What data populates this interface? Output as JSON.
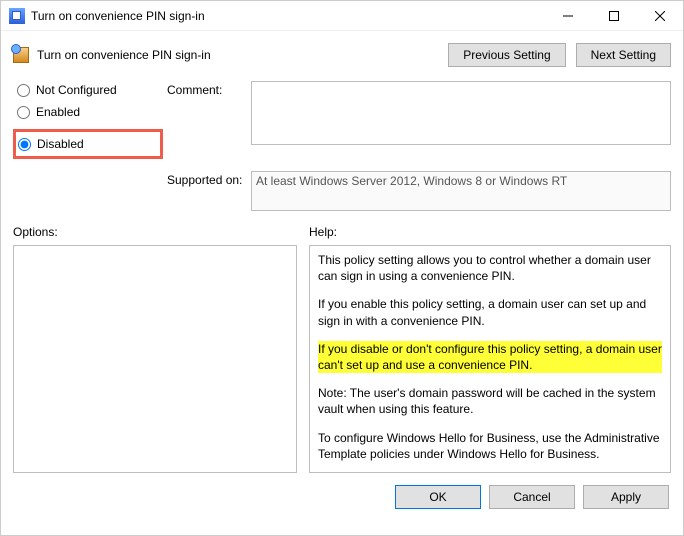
{
  "window": {
    "title": "Turn on convenience PIN sign-in"
  },
  "header": {
    "policy_name": "Turn on convenience PIN sign-in",
    "prev_label": "Previous Setting",
    "next_label": "Next Setting"
  },
  "radios": {
    "not_configured": "Not Configured",
    "enabled": "Enabled",
    "disabled": "Disabled",
    "selected": "disabled"
  },
  "labels": {
    "comment": "Comment:",
    "supported_on": "Supported on:",
    "options": "Options:",
    "help": "Help:"
  },
  "fields": {
    "comment": "",
    "supported_on": "At least Windows Server 2012, Windows 8 or Windows RT"
  },
  "help": {
    "p1": "This policy setting allows you to control whether a domain user can sign in using a convenience PIN.",
    "p2": "If you enable this policy setting, a domain user can set up and sign in with a convenience PIN.",
    "p3": "If you disable or don't configure this policy setting, a domain user can't set up and use a convenience PIN.",
    "p4": "Note: The user's domain password will be cached in the system vault when using this feature.",
    "p5": "To configure Windows Hello for Business, use the Administrative Template policies under Windows Hello for Business."
  },
  "footer": {
    "ok": "OK",
    "cancel": "Cancel",
    "apply": "Apply"
  }
}
